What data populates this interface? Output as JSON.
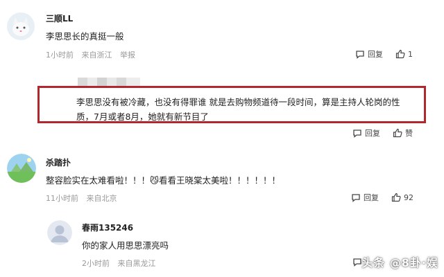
{
  "comments": [
    {
      "username": "三顺LL",
      "text": "李思思长的真挺一般",
      "time": "1小时前",
      "location": "来自浙江",
      "report": "举报",
      "reply_label": "回复",
      "like_count": "1"
    },
    {
      "text_line1": "李思思没有被冷藏，也没有得罪谁 就是去购物频道待一段时间，算是主持人轮岗的性",
      "text_line2": "质，7月或者8月，她就有新节目了",
      "reply_label": "回复",
      "like_label": "赞"
    },
    {
      "username": "杀踏扑",
      "text": "整容脸实在太难看啦！！！😼看看王晓棠太美啦！！！！！！",
      "time": "11小时前",
      "location": "来自北京",
      "reply_label": "回复",
      "like_count": "92"
    },
    {
      "username": "春雨135246",
      "text": "你的家人用思思漂亮吗",
      "time": "2小时前",
      "location": "来自黑龙江"
    }
  ],
  "watermark": "头条 @8卦·娱"
}
